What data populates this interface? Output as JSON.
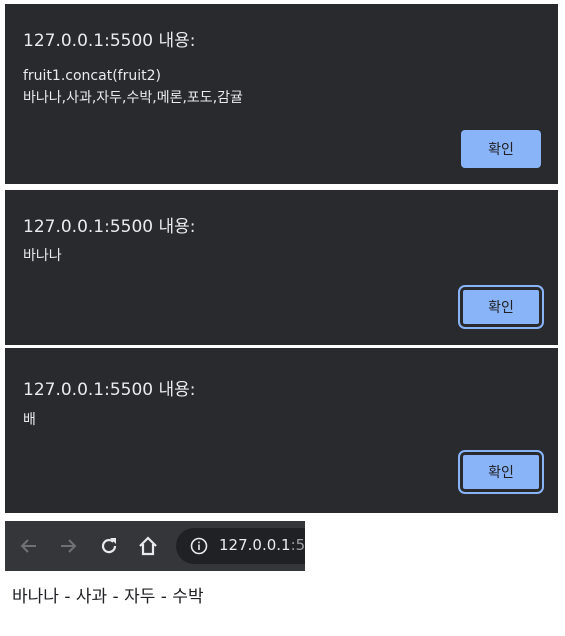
{
  "dialogs": [
    {
      "title": "127.0.0.1:5500 내용:",
      "message_lines": [
        "fruit1.concat(fruit2)",
        "바나나,사과,자두,수박,메론,포도,감귤"
      ],
      "ok_label": "확인"
    },
    {
      "title": "127.0.0.1:5500 내용:",
      "message_lines": [
        "바나나"
      ],
      "ok_label": "확인"
    },
    {
      "title": "127.0.0.1:5500 내용:",
      "message_lines": [
        "배"
      ],
      "ok_label": "확인"
    }
  ],
  "browser": {
    "url_host": "127.0.0.1",
    "url_port_partial": ":5",
    "icons": [
      "back-arrow-icon",
      "forward-arrow-icon",
      "reload-icon",
      "home-icon",
      "info-icon"
    ]
  },
  "page": {
    "text": "바나나 - 사과 - 자두 - 수박"
  },
  "colors": {
    "dialog_bg": "#292a2d",
    "dialog_text": "#e8eaed",
    "button_bg": "#8ab4f8",
    "toolbar_bg": "#35363a",
    "omnibox_bg": "#202124"
  }
}
